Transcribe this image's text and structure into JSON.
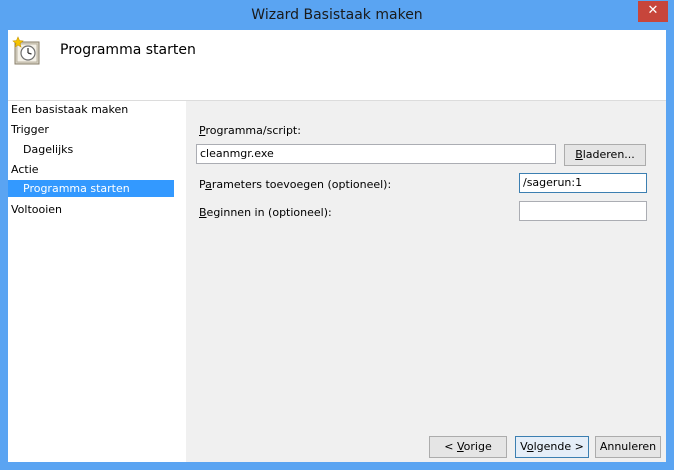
{
  "window": {
    "title": "Wizard Basistaak maken",
    "close_glyph": "✕"
  },
  "header": {
    "icon": "task-clock-icon",
    "title": "Programma starten"
  },
  "sidebar": {
    "items": [
      {
        "label": "Een basistaak maken",
        "level": 1,
        "selected": false
      },
      {
        "label": "Trigger",
        "level": 1,
        "selected": false
      },
      {
        "label": "Dagelijks",
        "level": 2,
        "selected": false
      },
      {
        "label": "Actie",
        "level": 1,
        "selected": false
      },
      {
        "label": "Programma starten",
        "level": 2,
        "selected": true
      },
      {
        "label": "Voltooien",
        "level": 1,
        "selected": false
      }
    ],
    "selected_color": "#3399ff"
  },
  "form": {
    "program_label_key": "P",
    "program_label_rest": "rogramma/script:",
    "program_value": "cleanmgr.exe",
    "browse_label_key": "B",
    "browse_label_rest": "laderen...",
    "params_label_pre": "P",
    "params_label_key": "a",
    "params_label_rest": "rameters toevoegen (optioneel):",
    "params_value": "/sagerun:1",
    "start_in_label_key": "B",
    "start_in_label_rest": "eginnen in (optioneel):",
    "start_in_value": ""
  },
  "footer": {
    "back_label_pre": "< ",
    "back_label_key": "V",
    "back_label_rest": "orige",
    "next_label_pre": "V",
    "next_label_key": "o",
    "next_label_rest": "lgende >",
    "cancel_label": "Annuleren"
  },
  "colors": {
    "titlebar": "#5aa4f2",
    "close": "#c7453b",
    "focus_border": "#3c7fb1"
  }
}
